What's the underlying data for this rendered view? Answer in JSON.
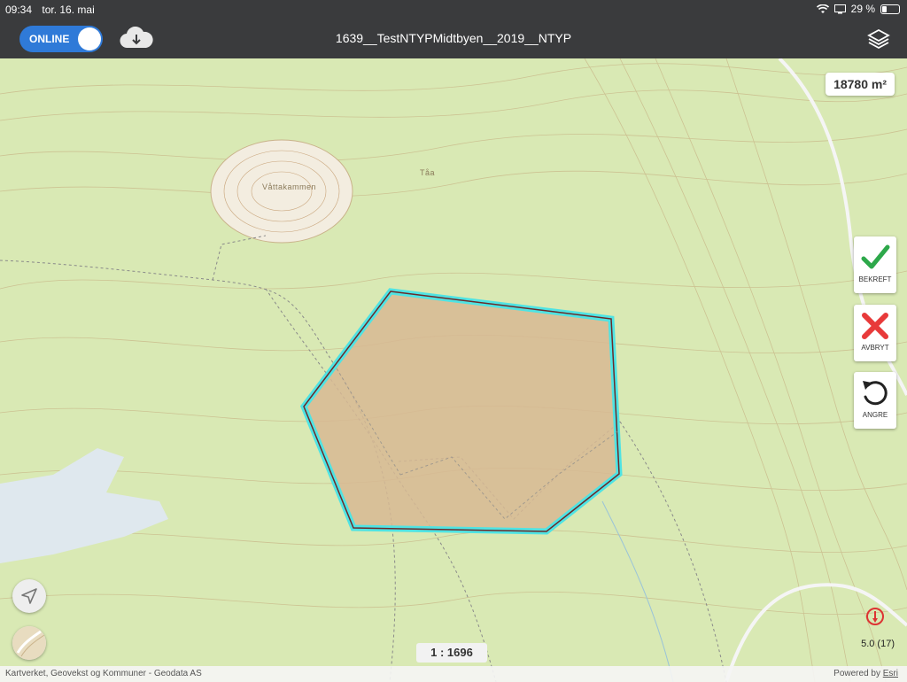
{
  "status_bar": {
    "time": "09:34",
    "date": "tor. 16. mai",
    "battery_text": "29 %",
    "battery_level": 0.29
  },
  "toolbar": {
    "online_label": "ONLINE",
    "title": "1639__TestNTYPMidtbyen__2019__NTYP"
  },
  "map": {
    "area": "18780 m²",
    "scale": "1 : 1696",
    "zoom": "5.0 (17)",
    "labels": {
      "peak": "Våttakammen",
      "area_name": "Tåa"
    },
    "attribution": "Kartverket, Geovekst og Kommuner - Geodata AS",
    "powered_by": "Powered by",
    "powered_by_link": "Esri"
  },
  "actions": {
    "confirm_label": "BEKREFT",
    "cancel_label": "AVBRYT",
    "undo_label": "ANGRE"
  },
  "colors": {
    "toolbar": "#3a3b3d",
    "toggle": "#2f7ad8",
    "map_bg": "#d9e9b4",
    "polygon_fill": "#d7b893",
    "polygon_outline": "#4fe3e3",
    "confirm": "#2da84a",
    "cancel": "#e83a3a"
  }
}
